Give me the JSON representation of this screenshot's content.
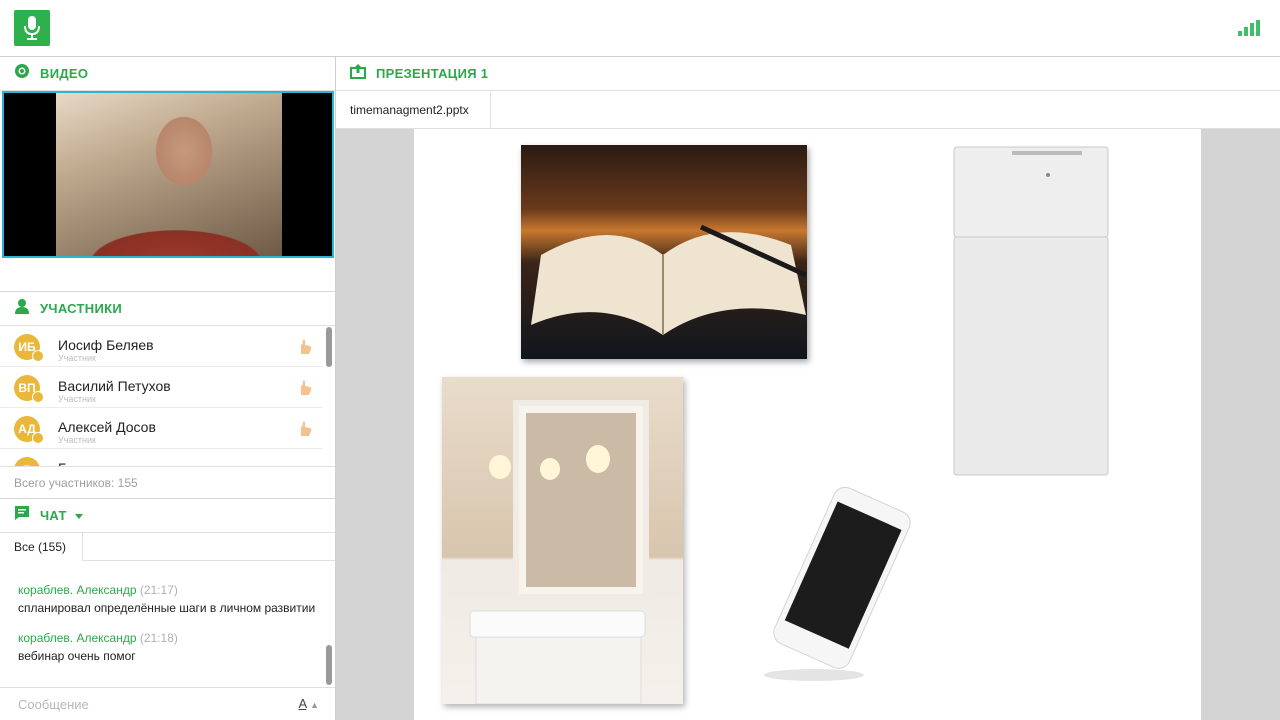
{
  "colors": {
    "accent": "#2aa84a",
    "logo_bg": "#2db14c",
    "video_border": "#29b6d6",
    "avatar": "#e9b73a"
  },
  "top": {
    "logo_icon": "microphone-icon",
    "signal_icon": "signal-bars-icon"
  },
  "video": {
    "title": "ВИДЕО"
  },
  "participants": {
    "title": "УЧАСТНИКИ",
    "items": [
      {
        "initials": "ИБ",
        "name": "Иосиф Беляев",
        "role": "Участник"
      },
      {
        "initials": "ВП",
        "name": "Василий Петухов",
        "role": "Участник"
      },
      {
        "initials": "АД",
        "name": "Алексей Досов",
        "role": "Участник"
      },
      {
        "initials": "Б",
        "name": "Б",
        "role": ""
      }
    ],
    "total": "Всего участников: 155"
  },
  "chat": {
    "title": "ЧАТ",
    "tab_all": "Все (155)",
    "messages": [
      {
        "author": "кораблев. Александр",
        "time": "(21:17)",
        "text": "спланировал определённые шаги в личном развитии"
      },
      {
        "author": "кораблев. Александр",
        "time": "(21:18)",
        "text": "вебинар очень помог"
      }
    ],
    "input_placeholder": "Сообщение",
    "font_button": "A"
  },
  "presentation": {
    "title": "ПРЕЗЕНТАЦИЯ 1",
    "file_tab": "timemanagment2.pptx"
  }
}
